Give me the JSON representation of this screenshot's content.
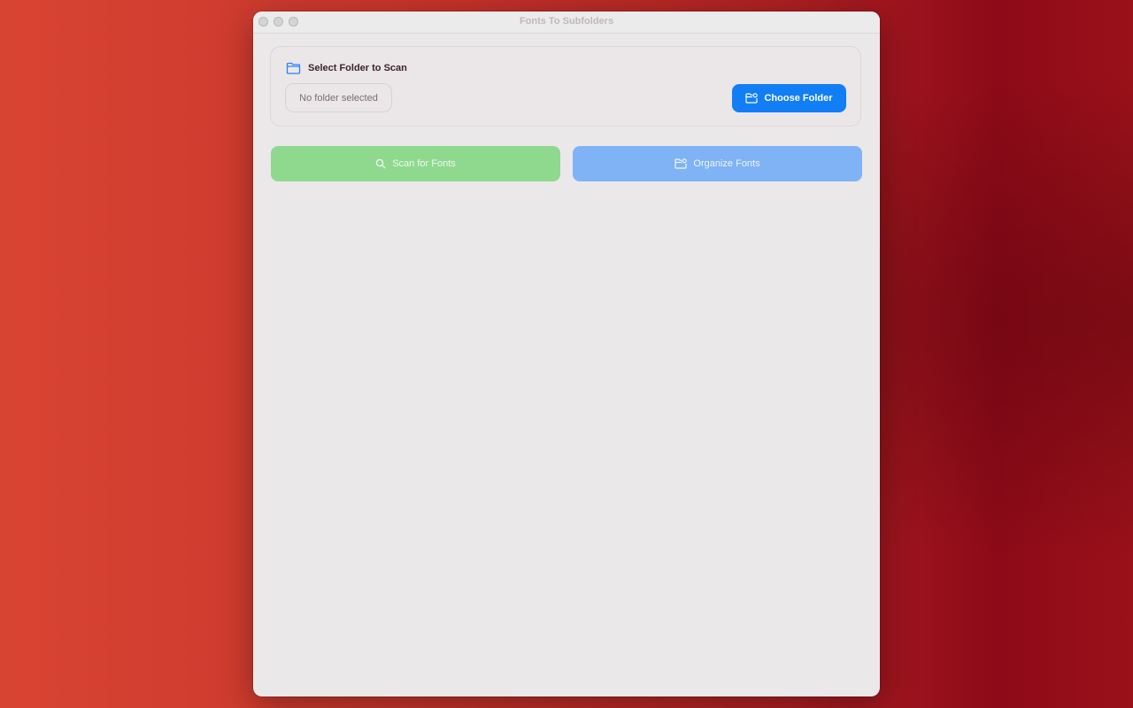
{
  "window": {
    "title": "Fonts To Subfolders"
  },
  "folder_section": {
    "title": "Select Folder to Scan",
    "title_icon": "folder-icon",
    "path_text": "No folder selected",
    "choose_button": {
      "label": "Choose Folder",
      "icon": "folder-badge-icon"
    }
  },
  "actions": {
    "scan": {
      "label": "Scan for Fonts",
      "icon": "magnifier-icon",
      "enabled": false
    },
    "organize": {
      "label": "Organize Fonts",
      "icon": "folder-badge-icon",
      "enabled": false
    }
  },
  "colors": {
    "accent": "#127ef5",
    "scan_disabled": "#8fd98f",
    "organize_disabled": "#7fb3f5"
  }
}
